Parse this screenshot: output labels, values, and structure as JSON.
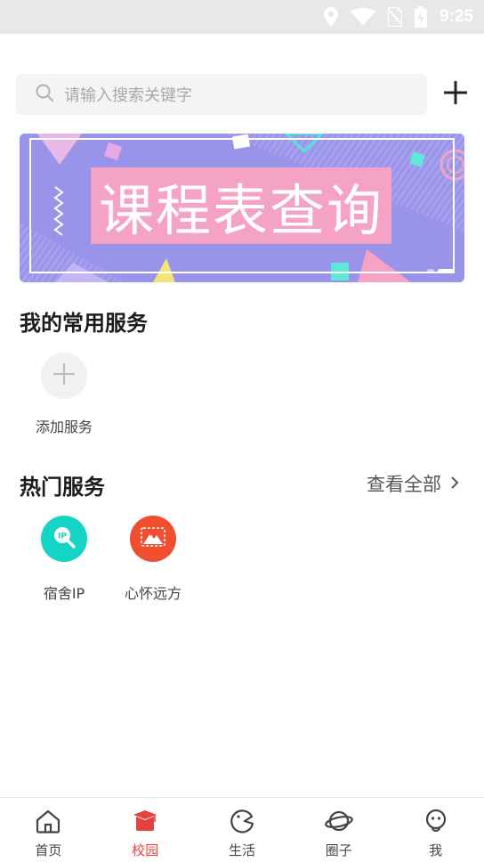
{
  "status_bar": {
    "time": "9:25"
  },
  "search": {
    "placeholder": "请输入搜索关键字"
  },
  "banner": {
    "title": "课程表查询"
  },
  "common_services": {
    "title": "我的常用服务",
    "items": [
      {
        "label": "添加服务",
        "icon": "plus-icon"
      }
    ]
  },
  "hot_services": {
    "title": "热门服务",
    "see_all": "查看全部",
    "items": [
      {
        "label": "宿舍IP",
        "icon": "ip-search-icon",
        "color": "#13d4c5"
      },
      {
        "label": "心怀远方",
        "icon": "mountain-icon",
        "color": "#f04e2e"
      }
    ]
  },
  "nav": {
    "items": [
      {
        "label": "首页",
        "icon": "home-icon"
      },
      {
        "label": "校园",
        "icon": "campus-icon",
        "active": true
      },
      {
        "label": "生活",
        "icon": "life-icon"
      },
      {
        "label": "圈子",
        "icon": "planet-icon"
      },
      {
        "label": "我",
        "icon": "profile-icon"
      }
    ],
    "active_color": "#e5413d"
  }
}
